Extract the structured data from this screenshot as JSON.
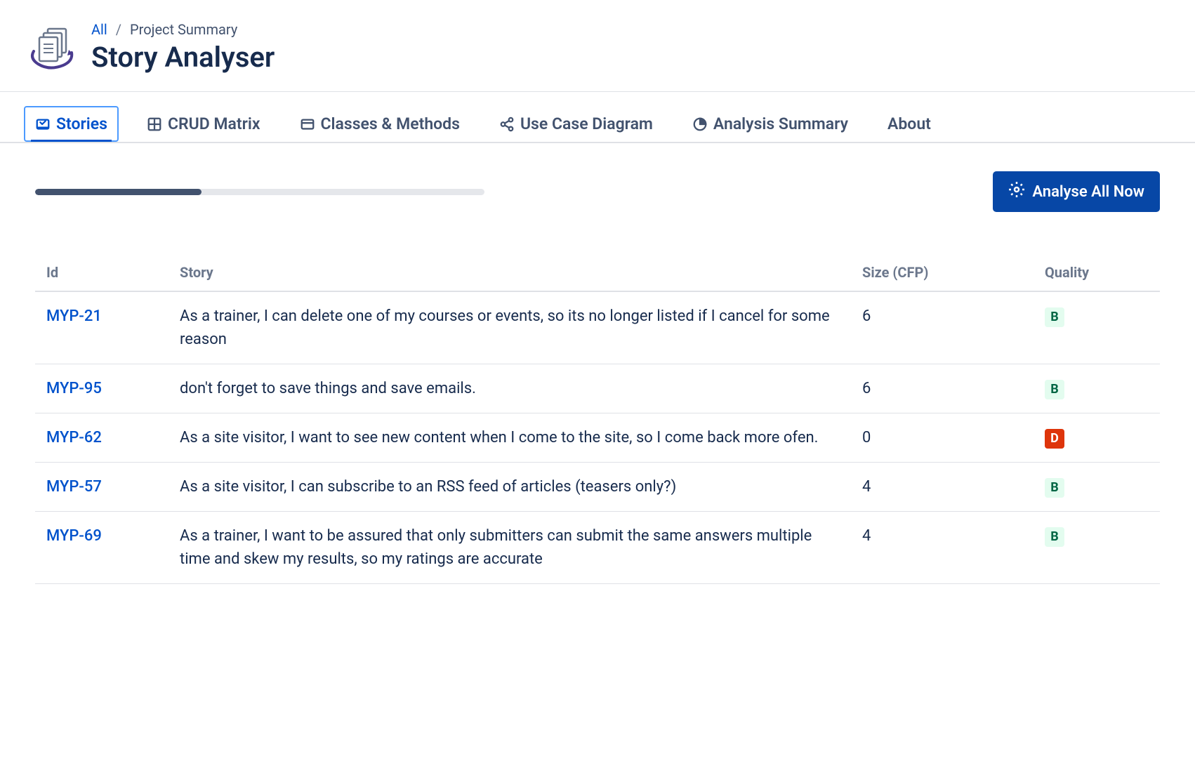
{
  "header": {
    "breadcrumb": {
      "all": "All",
      "current": "Project Summary"
    },
    "title": "Story Analyser"
  },
  "tabs": {
    "stories": "Stories",
    "crud": "CRUD Matrix",
    "classes": "Classes & Methods",
    "usecase": "Use Case Diagram",
    "analysis": "Analysis Summary",
    "about": "About"
  },
  "progress": {
    "percent": 37
  },
  "button": {
    "analyse_all": "Analyse All Now"
  },
  "table": {
    "headers": {
      "id": "Id",
      "story": "Story",
      "size": "Size (CFP)",
      "quality": "Quality"
    },
    "rows": [
      {
        "id": "MYP-21",
        "story": "As a trainer, I can delete one of my courses or events, so its no longer listed if I cancel for some reason",
        "size": "6",
        "quality": "B"
      },
      {
        "id": "MYP-95",
        "story": "don't forget to save things and save emails.",
        "size": "6",
        "quality": "B"
      },
      {
        "id": "MYP-62",
        "story": "As a site visitor, I want to see new content when I come to the site, so I come back more ofen.",
        "size": "0",
        "quality": "D"
      },
      {
        "id": "MYP-57",
        "story": "As a site visitor, I can subscribe to an RSS feed of articles (teasers only?)",
        "size": "4",
        "quality": "B"
      },
      {
        "id": "MYP-69",
        "story": "As a trainer, I want to be assured that only submitters can submit the same answers multiple time and skew my results, so my ratings are accurate",
        "size": "4",
        "quality": "B"
      }
    ]
  }
}
